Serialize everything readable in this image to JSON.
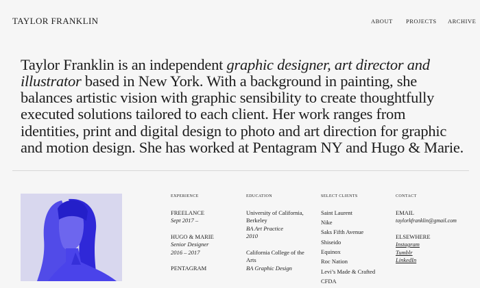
{
  "header": {
    "logo": "TAYLOR FRANKLIN",
    "nav": [
      "ABOUT",
      "PROJECTS",
      "ARCHIVE"
    ]
  },
  "intro": {
    "before": "Taylor Franklin is an independent ",
    "italic": "graphic designer, art director and illustrator",
    "after": " based in New York. With a background in painting, she balances artistic vision with graphic sensibility to create thoughtfully executed solutions tailored to each client. Her work ranges from identities, print and digital design to photo and art direction for graphic and motion design. She has worked at Pentagram NY and Hugo & Marie."
  },
  "experience": {
    "heading": "EXPERIENCE",
    "items": [
      {
        "title": "FREELANCE",
        "detail": "Sept 2017 –"
      },
      {
        "title": "HUGO & MARIE",
        "role": "Senior Designer",
        "detail": "2016 – 2017"
      },
      {
        "title": "PENTAGRAM"
      }
    ]
  },
  "education": {
    "heading": "EDUCATION",
    "items": [
      {
        "school": "University of California, Berkeley",
        "degree": "BA Art Practice",
        "year": "2010"
      },
      {
        "school": "California College of the Arts",
        "degree": "BA Graphic Design"
      }
    ]
  },
  "clients": {
    "heading": "SELECT CLIENTS",
    "items": [
      "Saint Laurent",
      "Nike",
      "Saks Fifth Avenue",
      "Shiseido",
      "Equinox",
      "Roc Nation",
      "Levi’s Made & Crafted",
      "CFDA"
    ]
  },
  "contact": {
    "heading": "CONTACT",
    "email_label": "EMAIL",
    "email": "taylorkfranklin@gmail.com",
    "elsewhere_label": "ELSEWHERE",
    "links": [
      "Instagram",
      "Tumblr",
      "LinkedIn"
    ]
  },
  "colors": {
    "background": "#f6f6f6",
    "text": "#1c1c1c",
    "portrait_tint": "#3a32e6"
  }
}
